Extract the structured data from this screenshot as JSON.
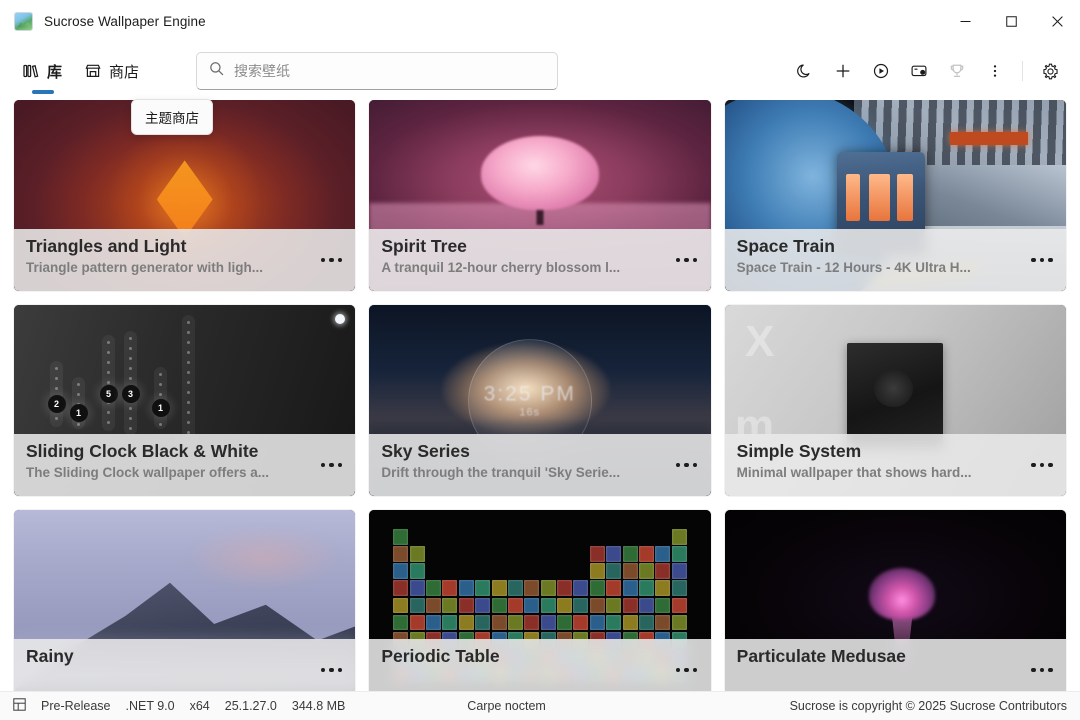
{
  "window": {
    "title": "Sucrose Wallpaper Engine",
    "app_icon": "picture-icon",
    "minimize_label": "Minimize",
    "maximize_label": "Maximize",
    "close_label": "Close"
  },
  "nav": {
    "tabs": [
      {
        "label": "库",
        "icon": "library-icon",
        "active": true
      },
      {
        "label": "商店",
        "icon": "store-icon",
        "active": false
      }
    ],
    "active_accent": "#2a74b8"
  },
  "search": {
    "placeholder": "搜索壁纸",
    "value": "",
    "icon": "search-icon"
  },
  "toolbar_actions": [
    {
      "name": "moon-icon",
      "label": "夜间模式",
      "dim": false
    },
    {
      "name": "plus-icon",
      "label": "添加壁纸",
      "dim": false
    },
    {
      "name": "play-circle-icon",
      "label": "播放",
      "dim": false
    },
    {
      "name": "monitor-icon",
      "label": "显示器",
      "dim": false
    },
    {
      "name": "trophy-icon",
      "label": "成就",
      "dim": true
    },
    {
      "name": "more-vertical-icon",
      "label": "更多",
      "dim": false
    },
    {
      "name": "gear-icon",
      "label": "设置",
      "dim": false
    }
  ],
  "tooltip": {
    "text": "主题商店",
    "visible": true
  },
  "library": {
    "cards": [
      {
        "title": "Triangles and Light",
        "description": "Triangle pattern generator with ligh...",
        "art": "t-triangles",
        "applied": false,
        "more_label": "更多选项"
      },
      {
        "title": "Spirit Tree",
        "description": "A tranquil 12-hour cherry blossom l...",
        "art": "t-spirit",
        "applied": false,
        "more_label": "更多选项"
      },
      {
        "title": "Space Train",
        "description": "Space Train - 12 Hours - 4K Ultra H...",
        "art": "t-space",
        "applied": false,
        "more_label": "更多选项"
      },
      {
        "title": "Sliding Clock Black & White",
        "description": "The Sliding Clock wallpaper offers a...",
        "art": "t-clock",
        "applied": true,
        "more_label": "更多选项"
      },
      {
        "title": "Sky Series",
        "description": "Drift through the tranquil 'Sky Serie...",
        "art": "t-sky",
        "applied": false,
        "more_label": "更多选项"
      },
      {
        "title": "Simple System",
        "description": "Minimal wallpaper that shows hard...",
        "art": "t-simple",
        "applied": false,
        "more_label": "更多选项"
      },
      {
        "title": "Rainy",
        "description": "",
        "art": "t-rainy",
        "applied": false,
        "more_label": "更多选项"
      },
      {
        "title": "Periodic Table",
        "description": "",
        "art": "t-periodic",
        "applied": false,
        "more_label": "更多选项"
      },
      {
        "title": "Particulate Medusae",
        "description": "",
        "art": "t-medusa",
        "applied": false,
        "more_label": "更多选项"
      }
    ]
  },
  "statusbar": {
    "icon": "grid-icon",
    "channel": "Pre-Release",
    "runtime": ".NET 9.0",
    "arch": "x64",
    "version": "25.1.27.0",
    "memory": "344.8 MB",
    "motto": "Carpe noctem",
    "copyright": "Sucrose is copyright © 2025 Sucrose Contributors"
  }
}
